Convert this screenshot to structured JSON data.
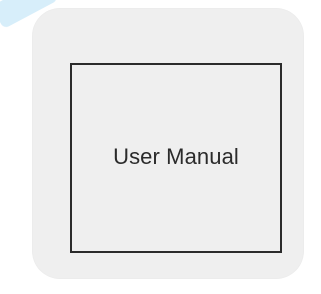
{
  "card": {
    "title": "User Manual"
  },
  "colors": {
    "background": "#ffffff",
    "card_background": "#efefef",
    "frame_border": "#2b2b2b",
    "text": "#2b2b2b",
    "corner_accent": "#b7e0f5"
  }
}
